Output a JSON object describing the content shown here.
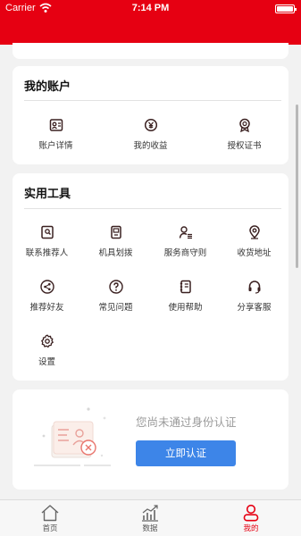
{
  "status_bar": {
    "carrier": "Carrier",
    "time": "7:14 PM"
  },
  "account": {
    "title": "我的账户",
    "items": [
      {
        "label": "账户详情",
        "icon": "account-detail-icon"
      },
      {
        "label": "我的收益",
        "icon": "earnings-icon"
      },
      {
        "label": "授权证书",
        "icon": "certificate-icon"
      }
    ]
  },
  "tools": {
    "title": "实用工具",
    "items": [
      {
        "label": "联系推荐人",
        "icon": "contact-referrer-icon"
      },
      {
        "label": "机具划拨",
        "icon": "device-transfer-icon"
      },
      {
        "label": "服务商守则",
        "icon": "provider-rules-icon"
      },
      {
        "label": "收货地址",
        "icon": "location-pin-icon"
      },
      {
        "label": "推荐好友",
        "icon": "share-icon"
      },
      {
        "label": "常见问题",
        "icon": "question-icon"
      },
      {
        "label": "使用帮助",
        "icon": "notebook-icon"
      },
      {
        "label": "分享客服",
        "icon": "headset-icon"
      },
      {
        "label": "设置",
        "icon": "gear-icon"
      }
    ]
  },
  "verification": {
    "message": "您尚未通过身份认证",
    "button_label": "立即认证"
  },
  "tabbar": {
    "items": [
      {
        "label": "首页",
        "icon": "home-icon",
        "active": false
      },
      {
        "label": "数据",
        "icon": "chart-icon",
        "active": false
      },
      {
        "label": "我的",
        "icon": "user-icon",
        "active": true
      }
    ]
  },
  "colors": {
    "brand_red": "#e60012",
    "button_blue": "#3d85e8",
    "icon_dark": "#3a2020"
  }
}
